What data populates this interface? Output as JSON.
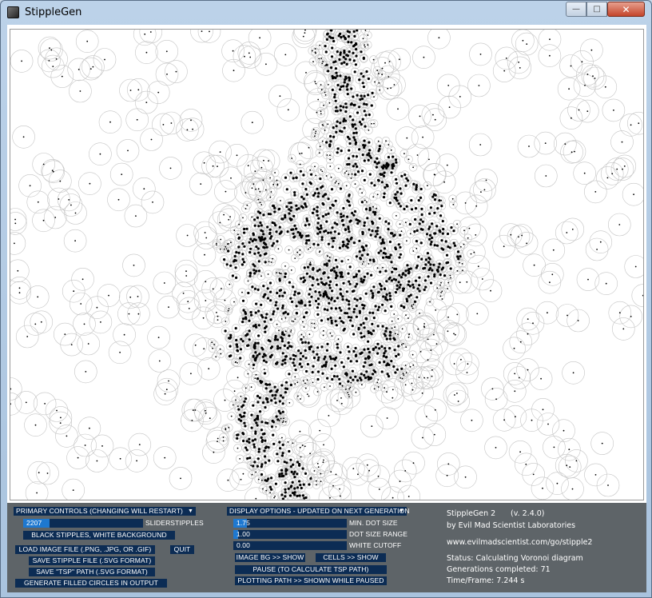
{
  "window": {
    "title": "StippleGen"
  },
  "controls": {
    "primary_dropdown": "PRIMARY CONTROLS (CHANGING WILL RESTART)",
    "stipples_value": "2207",
    "stipples_fill": 0.22,
    "stipples_label": "SLIDERSTIPPLES",
    "color_button": "BLACK STIPPLES, WHITE BACKGROUND",
    "load_button": "LOAD IMAGE FILE (.PNG, .JPG, OR .GIF)",
    "quit_button": "QUIT",
    "save_svg_button": "SAVE STIPPLE FILE (.SVG FORMAT)",
    "save_tsp_button": "SAVE \"TSP\" PATH (.SVG FORMAT)",
    "filled_button": "GENERATE FILLED CIRCLES IN OUTPUT",
    "display_dropdown": "DISPLAY OPTIONS - UPDATED ON NEXT GENERATION",
    "min_dot_value": "1.75",
    "min_dot_fill": 0.12,
    "min_dot_label": "MIN. DOT SIZE",
    "dot_range_value": "1.00",
    "dot_range_fill": 0.04,
    "dot_range_label": "DOT SIZE RANGE",
    "white_cutoff_value": "0.00",
    "white_cutoff_fill": 0.0,
    "white_cutoff_label": "WHITE CUTOFF",
    "image_bg_button": "IMAGE BG >> SHOW",
    "cells_button": "CELLS >> SHOW",
    "pause_button": "PAUSE (TO CALCULATE TSP PATH)",
    "plotting_button": "PLOTTING PATH >> SHOWN WHILE PAUSED"
  },
  "info": {
    "app_name": "StippleGen 2",
    "version": "(v. 2.4.0)",
    "author": "by Evil Mad Scientist Laboratories",
    "url": "www.evilmadscientist.com/go/stipple2",
    "status": "Status: Calculating Voronoi diagram",
    "generations": "Generations completed: 71",
    "time_frame": "Time/Frame: 7.244 s"
  },
  "colors": {
    "panel_bg": "#5e6468",
    "control_bg": "#0c2c54",
    "slider_fill": "#1e78d0",
    "cell_stroke": "#c4c4c4",
    "stipple": "#000000"
  }
}
